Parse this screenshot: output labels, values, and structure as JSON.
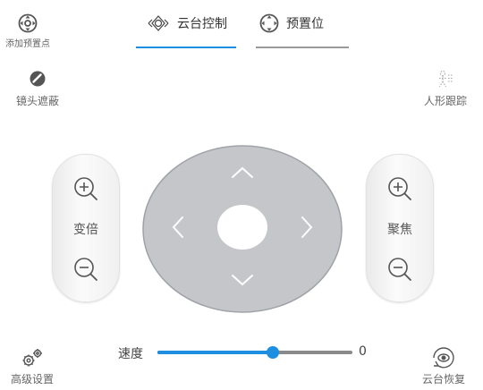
{
  "top_left": {
    "label": "添加预置点",
    "icon": "add-preset-icon"
  },
  "tabs": [
    {
      "label": "云台控制",
      "icon": "ptz-icon",
      "active": true
    },
    {
      "label": "预置位",
      "icon": "preset-icon",
      "active": false
    }
  ],
  "lens_mask": {
    "label": "镜头遮蔽",
    "icon": "lens-mask-icon"
  },
  "human_track": {
    "label": "人形跟踪",
    "icon": "human-track-icon"
  },
  "zoom": {
    "label": "变倍"
  },
  "focus": {
    "label": "聚焦"
  },
  "speed": {
    "label": "速度",
    "value": "0",
    "fill_fraction": 0.59
  },
  "advanced": {
    "label": "高级设置",
    "icon": "gears-icon"
  },
  "restore": {
    "label": "云台恢复",
    "icon": "ptz-restore-icon"
  },
  "colors": {
    "accent": "#1e8ee0",
    "track_gray": "#8a8a8a",
    "joystick": "#c4c6ca",
    "joystick_border": "#9fa3a8"
  }
}
